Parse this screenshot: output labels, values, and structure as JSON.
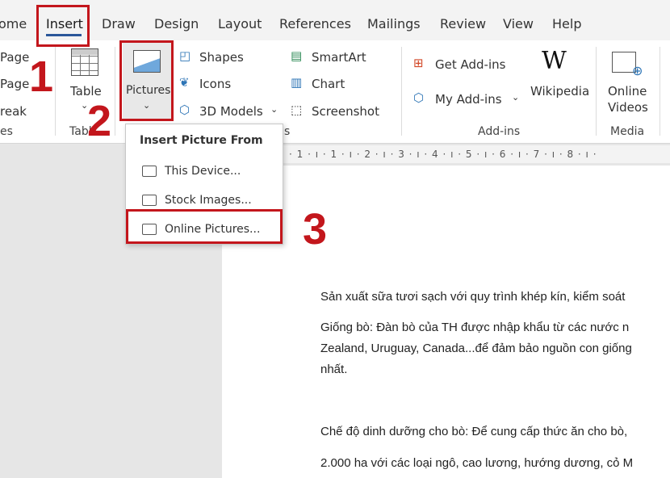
{
  "tabs": [
    "ome",
    "Insert",
    "Draw",
    "Design",
    "Layout",
    "References",
    "Mailings",
    "Review",
    "View",
    "Help"
  ],
  "active_tab": "Insert",
  "ribbon": {
    "pages": {
      "items": [
        "Page",
        "Page",
        "reak"
      ],
      "group": "es"
    },
    "table": {
      "label": "Table",
      "group": "Tabl"
    },
    "pictures": {
      "label": "Pictures"
    },
    "illustrations": {
      "items": [
        "Shapes",
        "Icons",
        "3D Models"
      ],
      "items2": [
        "SmartArt",
        "Chart",
        "Screenshot"
      ],
      "group": "s"
    },
    "addins": {
      "items": [
        "Get Add-ins",
        "My Add-ins"
      ],
      "wikipedia": "Wikipedia",
      "group": "Add-ins"
    },
    "media": {
      "label1": "Online",
      "label2": "Videos",
      "group": "Media"
    }
  },
  "ruler": "· 1 · ı · 1 · ı · 2 · ı · 3 · ı · 4 · ı · 5 · ı · 6 · ı · 7 · ı · 8 · ı ·",
  "menu": {
    "title": "Insert Picture From",
    "items": [
      "This Device...",
      "Stock Images...",
      "Online Pictures..."
    ]
  },
  "steps": [
    "1",
    "2",
    "3"
  ],
  "accent": "#c3161c",
  "document": {
    "paragraphs": [
      "Sản xuất sữa tươi sạch với quy trình khép kín, kiểm soát",
      "Giống bò: Đàn bò của TH được nhập khẩu từ các nước n",
      "Zealand, Uruguay, Canada...để đảm bảo nguồn con giống",
      "nhất.",
      "Chế độ dinh dưỡng cho bò: Để cung cấp thức ăn cho bò,",
      "2.000 ha với các loại ngô, cao lương, hướng dương, cỏ M"
    ]
  }
}
